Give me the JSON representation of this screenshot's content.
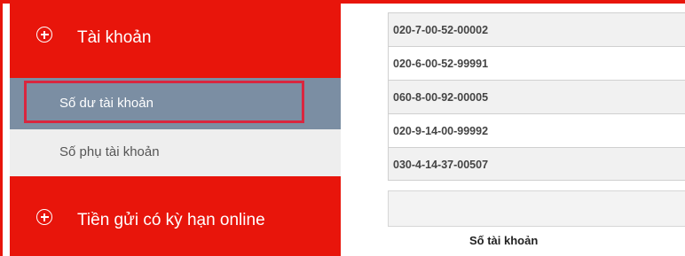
{
  "sidebar": {
    "sections": [
      {
        "label": "Tài khoản",
        "icon": "plus-circle-icon"
      },
      {
        "label": "Tiền gửi có kỳ hạn online",
        "icon": "plus-circle-icon"
      }
    ],
    "sub_items": [
      {
        "label": "Số dư tài khoản",
        "active": true
      },
      {
        "label": "Số phụ tài khoản",
        "active": false
      }
    ]
  },
  "accounts": {
    "rows": [
      "020-7-00-52-00002",
      "020-6-00-52-99991",
      "060-8-00-92-00005",
      "020-9-14-00-99992",
      "030-4-14-37-00507"
    ],
    "column_header": "Số tài khoản"
  },
  "colors": {
    "brand_red": "#e8150b",
    "active_item_bg": "#7b8ea3",
    "highlight_border": "#d9263f",
    "sub_item_bg": "#eeeeee"
  }
}
